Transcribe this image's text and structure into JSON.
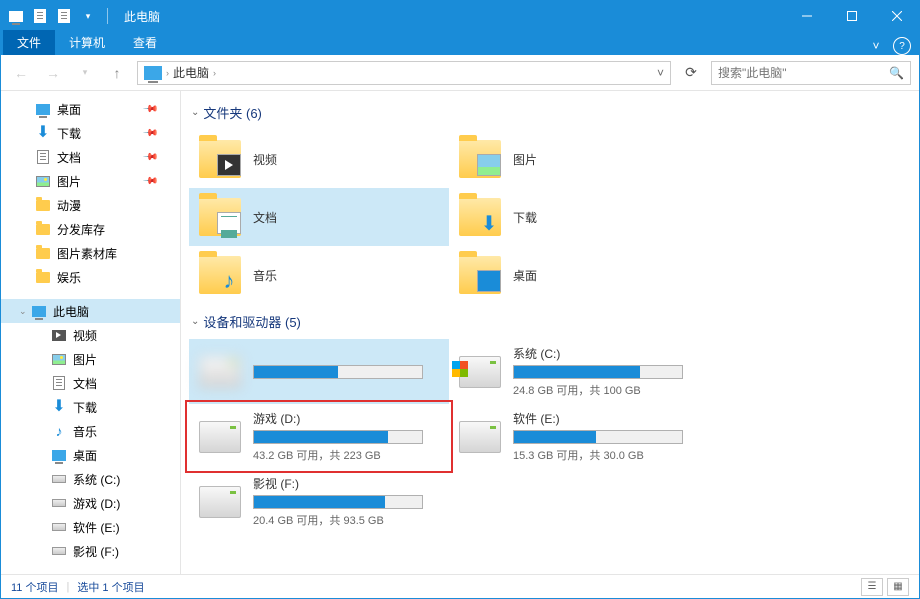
{
  "window": {
    "title": "此电脑"
  },
  "ribbon": {
    "file": "文件",
    "computer": "计算机",
    "view": "查看"
  },
  "address": {
    "crumb1": "此电脑"
  },
  "search": {
    "placeholder": "搜索\"此电脑\""
  },
  "sidebar": {
    "quick": [
      {
        "label": "桌面",
        "icon": "desktop",
        "pinned": true
      },
      {
        "label": "下载",
        "icon": "dl",
        "pinned": true
      },
      {
        "label": "文档",
        "icon": "doc",
        "pinned": true
      },
      {
        "label": "图片",
        "icon": "pic",
        "pinned": true
      },
      {
        "label": "动漫",
        "icon": "folder",
        "pinned": false
      },
      {
        "label": "分发库存",
        "icon": "folder",
        "pinned": false
      },
      {
        "label": "图片素材库",
        "icon": "folder",
        "pinned": false
      },
      {
        "label": "娱乐",
        "icon": "folder",
        "pinned": false
      }
    ],
    "thispc": {
      "label": "此电脑"
    },
    "pcchildren": [
      {
        "label": "视频",
        "icon": "video"
      },
      {
        "label": "图片",
        "icon": "pic"
      },
      {
        "label": "文档",
        "icon": "doc"
      },
      {
        "label": "下载",
        "icon": "dl"
      },
      {
        "label": "音乐",
        "icon": "music"
      },
      {
        "label": "桌面",
        "icon": "desktop"
      },
      {
        "label": "系统 (C:)",
        "icon": "hdd"
      },
      {
        "label": "游戏 (D:)",
        "icon": "hdd"
      },
      {
        "label": "软件 (E:)",
        "icon": "hdd"
      },
      {
        "label": "影视 (F:)",
        "icon": "hdd"
      }
    ]
  },
  "groups": {
    "folders": {
      "header": "文件夹 (6)"
    },
    "drives": {
      "header": "设备和驱动器 (5)"
    }
  },
  "folders": [
    {
      "label": "视频",
      "overlay": "video"
    },
    {
      "label": "图片",
      "overlay": "pic"
    },
    {
      "label": "文档",
      "overlay": "doc",
      "selected": true
    },
    {
      "label": "下载",
      "overlay": "dl"
    },
    {
      "label": "音乐",
      "overlay": "music"
    },
    {
      "label": "桌面",
      "overlay": "desktop"
    }
  ],
  "drives": [
    {
      "name": "",
      "stats": "",
      "fill": 50,
      "blurred": true,
      "selected": true
    },
    {
      "name": "系统 (C:)",
      "stats": "24.8 GB 可用，共 100 GB",
      "fill": 75,
      "os": true
    },
    {
      "name": "游戏 (D:)",
      "stats": "43.2 GB 可用，共 223 GB",
      "fill": 80,
      "highlighted": true
    },
    {
      "name": "软件 (E:)",
      "stats": "15.3 GB 可用，共 30.0 GB",
      "fill": 49
    },
    {
      "name": "影视 (F:)",
      "stats": "20.4 GB 可用，共 93.5 GB",
      "fill": 78
    }
  ],
  "statusbar": {
    "items": "11 个项目",
    "selected": "选中 1 个项目"
  }
}
